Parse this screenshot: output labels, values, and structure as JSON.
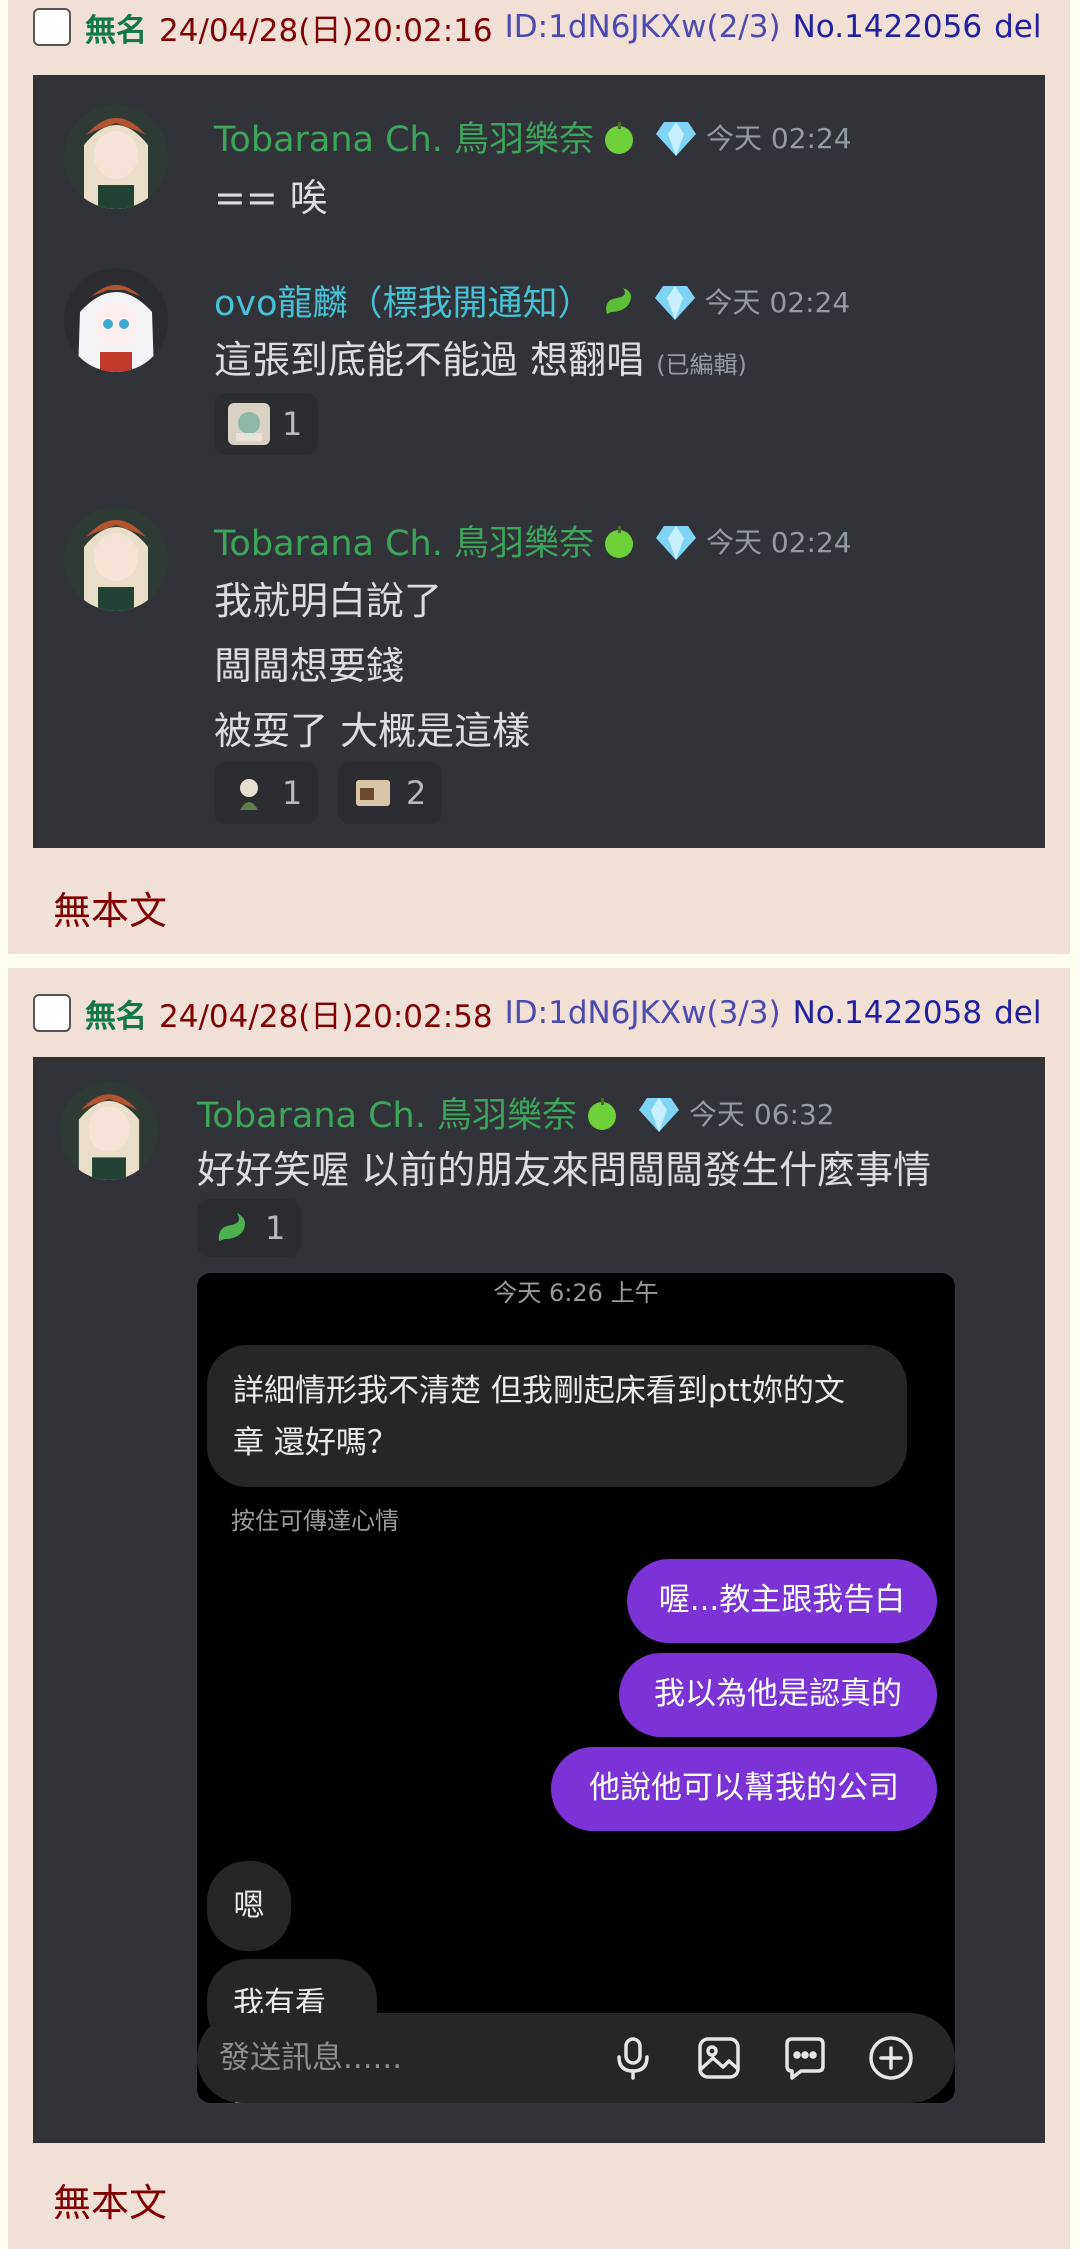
{
  "posts": [
    {
      "header": {
        "name": "無名",
        "datetime": "24/04/28(日)20:02:16",
        "id": "ID:1dN6JKXw(2/3)",
        "no": "No.1422056",
        "del": "del"
      },
      "body": "無本文",
      "chat": [
        {
          "user": "Tobarana Ch. 鳥羽樂奈",
          "time": "今天 02:24",
          "lines": [
            "== 唉"
          ]
        },
        {
          "user": "ovo龍麟（標我開通知）",
          "time": "今天 02:24",
          "lines": [
            "這張到底能不能過 想翻唱"
          ],
          "edited": "(已編輯)",
          "reactions": [
            {
              "count": "1"
            }
          ]
        },
        {
          "user": "Tobarana Ch. 鳥羽樂奈",
          "time": "今天 02:24",
          "lines": [
            "我就明白說了",
            "闆闆想要錢",
            "被耍了 大概是這樣"
          ],
          "reactions": [
            {
              "count": "1"
            },
            {
              "count": "2"
            }
          ]
        }
      ]
    },
    {
      "header": {
        "name": "無名",
        "datetime": "24/04/28(日)20:02:58",
        "id": "ID:1dN6JKXw(3/3)",
        "no": "No.1422058",
        "del": "del"
      },
      "body": "無本文",
      "chat": [
        {
          "user": "Tobarana Ch. 鳥羽樂奈",
          "time": "今天 06:32",
          "lines": [
            "好好笑喔 以前的朋友來問闆闆發生什麼事情"
          ],
          "reactions": [
            {
              "count": "1"
            }
          ]
        }
      ],
      "phone": {
        "time": "今天 6:26 上午",
        "incoming_1_line1": "詳細情形我不清楚 但我剛起床看到ptt妳的文",
        "incoming_1_line2": "章 還好嗎？",
        "hint": "按住可傳達心情",
        "out_1": "喔...教主跟我告白",
        "out_2": "我以為他是認真的",
        "out_3": "他說他可以幫我的公司",
        "incoming_2": "嗯",
        "incoming_3": "我有看到",
        "composer_placeholder": "發送訊息......"
      }
    }
  ],
  "colors": {
    "page_bg": "#FFFFEE",
    "post_bg": "#F0E0D6",
    "discord_bg": "#313338",
    "username_green": "#3ba55c",
    "username_cyan": "#46c1d6",
    "bubble_purple": "#7b33d6"
  }
}
